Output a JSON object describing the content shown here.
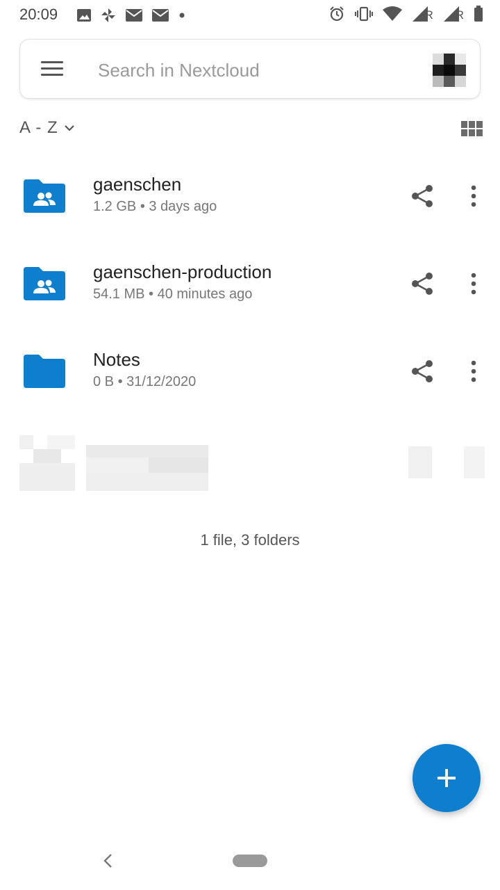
{
  "status_bar": {
    "time": "20:09",
    "left_icons": [
      "image-icon",
      "pinwheel-icon",
      "mail-icon",
      "mail-icon",
      "dot-icon"
    ],
    "right_icons": [
      "alarm-icon",
      "vibrate-icon",
      "wifi-icon",
      "signal-icon",
      "signal-icon",
      "battery-icon"
    ],
    "roaming_1": "R",
    "roaming_2": "R"
  },
  "search": {
    "placeholder": "Search in Nextcloud",
    "menu_icon": "hamburger-menu-icon",
    "avatar_icon": "avatar-icon"
  },
  "sort": {
    "label": "A - Z",
    "chevron_icon": "chevron-down-icon",
    "view_toggle_icon": "grid-view-icon"
  },
  "files": [
    {
      "name": "gaenschen",
      "size": "1.2 GB",
      "modified": "3 days ago",
      "meta": "1.2 GB • 3 days ago",
      "type": "shared-folder"
    },
    {
      "name": "gaenschen-production",
      "size": "54.1 MB",
      "modified": "40 minutes ago",
      "meta": "54.1 MB • 40 minutes ago",
      "type": "shared-folder"
    },
    {
      "name": "Notes",
      "size": "0 B",
      "modified": "31/12/2020",
      "meta": "0 B • 31/12/2020",
      "type": "folder"
    }
  ],
  "summary": "1 file, 3 folders",
  "colors": {
    "accent": "#0e7fcf",
    "text_primary": "#222222",
    "text_secondary": "#777777"
  },
  "fab": {
    "icon": "plus-icon"
  },
  "nav": {
    "back_icon": "back-chevron-icon",
    "home_icon": "home-pill-icon"
  }
}
